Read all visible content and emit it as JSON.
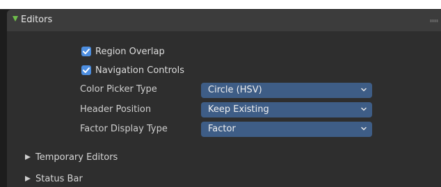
{
  "panel": {
    "title": "Editors",
    "expanded": true,
    "accent_color": "#6fbe4b"
  },
  "checkboxes": [
    {
      "label": "Region Overlap",
      "checked": true
    },
    {
      "label": "Navigation Controls",
      "checked": true
    }
  ],
  "properties": [
    {
      "label": "Color Picker Type",
      "value": "Circle (HSV)"
    },
    {
      "label": "Header Position",
      "value": "Keep Existing"
    },
    {
      "label": "Factor Display Type",
      "value": "Factor"
    }
  ],
  "subpanels": [
    {
      "label": "Temporary Editors",
      "expanded": false
    },
    {
      "label": "Status Bar",
      "expanded": false
    }
  ],
  "colors": {
    "checkbox": "#4d8ee0",
    "dropdown": "#3e5d86",
    "panel_bg": "#2e2e2e",
    "header_bg": "#3c3c3c"
  }
}
